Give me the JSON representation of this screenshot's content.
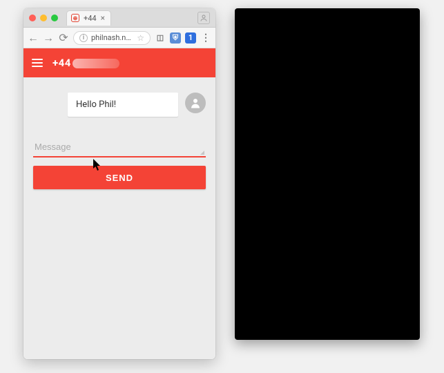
{
  "browser": {
    "tab": {
      "title": "+44",
      "favicon_label": "⊕",
      "close_label": "×"
    },
    "address": {
      "info_label": "i",
      "url_text": "philnash.ngro…",
      "star_label": "☆"
    },
    "extensions": {
      "cast_label": "◫",
      "shield_label": "⛨",
      "onePassword_label": "1",
      "menu_label": "⋮"
    },
    "nav": {
      "back_label": "←",
      "forward_label": "→",
      "reload_label": "⟳"
    }
  },
  "app": {
    "header": {
      "phone_prefix": "+44"
    },
    "messages": [
      {
        "text": "Hello Phil!",
        "mine": true
      }
    ],
    "compose": {
      "placeholder": "Message",
      "value": "",
      "send_label": "SEND"
    }
  },
  "colors": {
    "accent": "#f44336",
    "bg": "#ececec"
  }
}
